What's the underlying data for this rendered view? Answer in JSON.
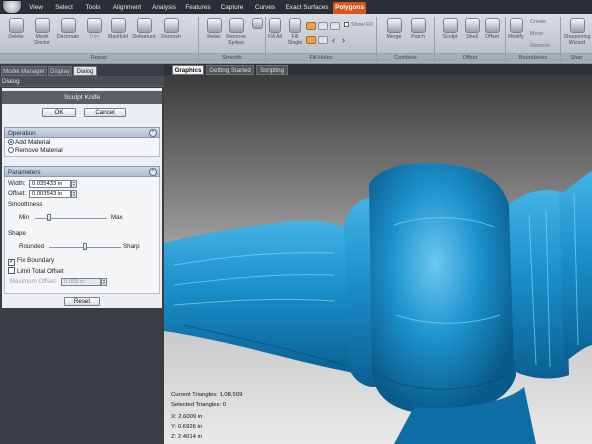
{
  "menu": {
    "tabs": [
      "View",
      "Select",
      "Tools",
      "Alignment",
      "Analysis",
      "Features",
      "Capture",
      "Curves",
      "Exact Surfaces",
      "Polygons"
    ],
    "active": "Polygons"
  },
  "ribbon": {
    "repair": {
      "group_label": "Repair",
      "buttons": [
        "Delete",
        "Mesh Doctor",
        "Decimate",
        "Trim",
        "Manifold",
        "Defeature",
        "Remesh"
      ]
    },
    "smooth": {
      "group_label": "Smooth",
      "buttons": [
        "Relax",
        "Remove Spikes"
      ]
    },
    "fill_holes": {
      "group_label": "Fill Holes",
      "buttons": [
        "Fill All",
        "Fill Single"
      ],
      "show_fill": "Show Fill"
    },
    "combine": {
      "group_label": "Combine",
      "buttons": [
        "Merge",
        "Patch"
      ]
    },
    "offset": {
      "group_label": "Offset",
      "buttons": [
        "Sculpt",
        "Shell",
        "Offset"
      ]
    },
    "boundaries": {
      "group_label": "Boundaries",
      "buttons": [
        "Modify"
      ],
      "small": [
        "Create",
        "Move",
        "Remove"
      ]
    },
    "sharpen": {
      "group_label": "Shar",
      "buttons": [
        "Sharpening Wizard"
      ]
    }
  },
  "left_panel": {
    "tabs": [
      "Model Manager",
      "Display",
      "Dialog"
    ],
    "active_tab": "Dialog",
    "dialog_title": "Dialog",
    "tool_title": "Sculpt Knife",
    "ok_label": "OK",
    "cancel_label": "Cancel",
    "operation": {
      "header": "Operation",
      "options": [
        "Add Material",
        "Remove Material"
      ],
      "selected": "Add Material"
    },
    "parameters": {
      "header": "Parameters",
      "width_label": "Width:",
      "width_value": "0.035433 in",
      "offset_label": "Offset:",
      "offset_value": "0.003543 in",
      "smoothness_label": "Smoothness",
      "smoothness_min": "Min",
      "smoothness_max": "Max",
      "smoothness_level": 0.2,
      "shape_label": "Shape",
      "shape_rounded": "Rounded",
      "shape_sharp": "Sharp",
      "shape_level": 0.5,
      "fix_boundary_label": "Fix Boundary",
      "fix_boundary_checked": true,
      "limit_total_label": "Limit Total Offset",
      "limit_total_checked": false,
      "max_offset_label": "Maximum Offset:",
      "max_offset_value": "0.008 in",
      "reset_label": "Reset"
    }
  },
  "graphics": {
    "tabs": [
      "Graphics",
      "Getting Started",
      "Scripting"
    ],
    "active_tab": "Graphics",
    "stats": {
      "current_triangles": "Current Triangles: 1,08,509",
      "selected_triangles": "Selected Triangles: 0"
    },
    "coords": {
      "x": "X:  2.6009 in",
      "y": "Y:  0.6926 in",
      "z": "Z:  2.4014 in"
    }
  },
  "colors": {
    "accent": "#d8561b",
    "model": "#1a8fc9"
  }
}
